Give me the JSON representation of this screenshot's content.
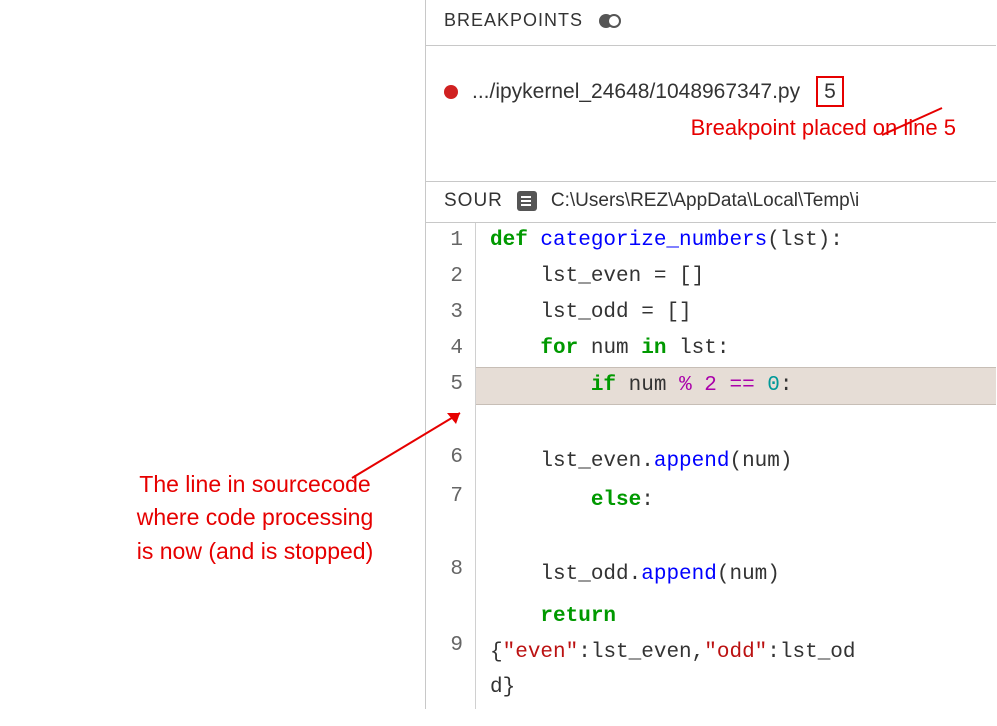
{
  "breakpoints_header": "BREAKPOINTS",
  "breakpoint": {
    "path": ".../ipykernel_24648/1048967347.py",
    "line": "5"
  },
  "annotation_bp": "Breakpoint placed on line 5",
  "source_header": "SOUR",
  "source_path": "C:\\Users\\REZ\\AppData\\Local\\Temp\\i",
  "gutter": [
    "1",
    "2",
    "3",
    "4",
    "5",
    "6",
    "7",
    "8",
    "9"
  ],
  "code": {
    "l1": {
      "kw": "def",
      "name": " categorize_numbers",
      "rest": "(lst):"
    },
    "l2": "    lst_even = []",
    "l3": "    lst_odd = []",
    "l4": {
      "kw1": "for",
      "mid": " num ",
      "kw2": "in",
      "rest": " lst:"
    },
    "l5": {
      "indent": "        ",
      "kw": "if",
      "mid": " num ",
      "op": "% 2 ==",
      "sp": " ",
      "num": "0",
      "colon": ":"
    },
    "l6": {
      "indent": "    ",
      "obj": "lst_even.",
      "fn": "append",
      "rest": "(num)"
    },
    "l7": {
      "indent": "        ",
      "kw": "else",
      "colon": ":"
    },
    "l8": {
      "indent": "    ",
      "obj": "lst_odd.",
      "fn": "append",
      "rest": "(num)"
    },
    "l9": {
      "indent": "    ",
      "kw": "return"
    },
    "l9b": {
      "open": "{",
      "k1": "\"even\"",
      "c1": ":lst_even,",
      "k2": "\"odd\"",
      "c2": ":lst_od",
      "cont": "d}"
    }
  },
  "annotation_left_l1": "The line in sourcecode",
  "annotation_left_l2": "where code processing",
  "annotation_left_l3": "is now (and is stopped)"
}
